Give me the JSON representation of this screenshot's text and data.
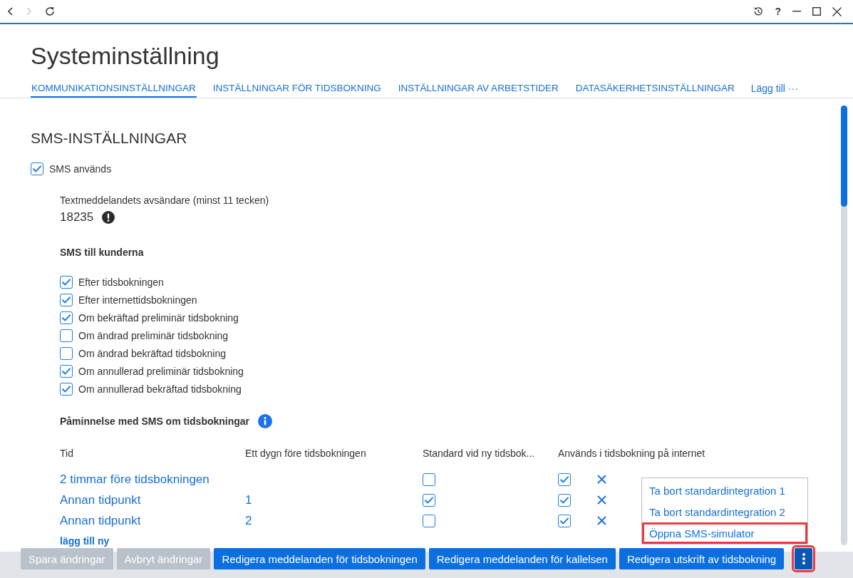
{
  "titlebar": {
    "back": {
      "disabled": false
    },
    "forward": {
      "disabled": true
    },
    "help": "?"
  },
  "header": {
    "title": "Systeminställning",
    "tabs": [
      {
        "label": "KOMMUNIKATIONSINSTÄLLNINGAR",
        "selected": true
      },
      {
        "label": "INSTÄLLNINGAR FÖR TIDSBOKNING",
        "selected": false
      },
      {
        "label": "INSTÄLLNINGAR AV ARBETSTIDER",
        "selected": false
      },
      {
        "label": "DATASÄKERHETSINSTÄLLNINGAR",
        "selected": false
      }
    ],
    "add_tab": "Lägg till ···"
  },
  "sms": {
    "heading": "SMS-INSTÄLLNINGAR",
    "sms_used": {
      "label": "SMS används",
      "checked": true
    },
    "sender": {
      "label": "Textmeddelandets avsändare (minst 11 tecken)",
      "value": "18235",
      "warning": true
    },
    "customer_sms": {
      "heading": "SMS till kunderna",
      "options": [
        {
          "label": "Efter tidsbokningen",
          "checked": true
        },
        {
          "label": "Efter internettidsbokningen",
          "checked": true
        },
        {
          "label": "Om bekräftad preliminär tidsbokning",
          "checked": true
        },
        {
          "label": "Om ändrad preliminär tidsbokning",
          "checked": false
        },
        {
          "label": "Om ändrad bekräftad tidsbokning",
          "checked": false
        },
        {
          "label": "Om annullerad preliminär tidsbokning",
          "checked": true
        },
        {
          "label": "Om annullerad bekräftad tidsbokning",
          "checked": true
        }
      ]
    },
    "reminders": {
      "heading": "Påminnelse med SMS om tidsbokningar",
      "columns": [
        "Tid",
        "Ett dygn före tidsbokningen",
        "Standard vid ny tidsbok...",
        "Används i tidsbokning på internet"
      ],
      "rows": [
        {
          "time": "2 timmar före tidsbokningen",
          "default_for_new": false,
          "used_online": true
        },
        {
          "time": "Annan tidpunkt",
          "day_before": "1",
          "default_for_new": true,
          "used_online": true
        },
        {
          "time": "Annan tidpunkt",
          "day_before": "2",
          "default_for_new": false,
          "used_online": true
        }
      ],
      "add_link": "lägg till ny"
    }
  },
  "footer": {
    "buttons": [
      {
        "label": "Spara ändringar",
        "disabled": true
      },
      {
        "label": "Avbryt ändringar",
        "disabled": true
      },
      {
        "label": "Redigera meddelanden för tidsbokningen",
        "disabled": false
      },
      {
        "label": "Redigera meddelanden för kallelsen",
        "disabled": false
      },
      {
        "label": "Redigera utskrift av tidsbokning",
        "disabled": false
      }
    ],
    "more_button": {
      "expanded": true,
      "highlighted": true
    }
  },
  "menu": {
    "items": [
      {
        "label": "Ta bort standardintegration 1",
        "highlighted": false
      },
      {
        "label": "Ta bort standardintegration 2",
        "highlighted": false
      },
      {
        "label": "Öppna SMS-simulator",
        "highlighted": true
      }
    ]
  }
}
